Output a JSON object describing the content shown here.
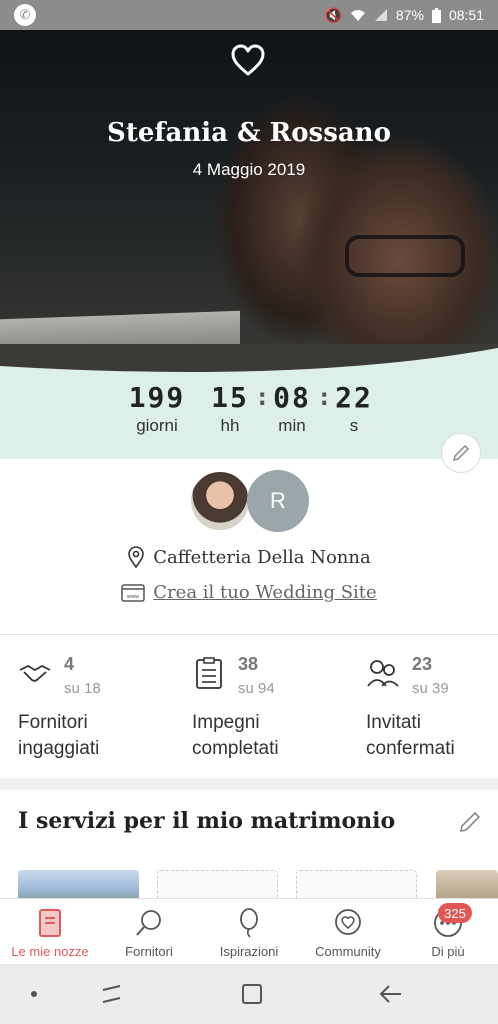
{
  "status_bar": {
    "battery": "87%",
    "time": "08:51"
  },
  "hero": {
    "couple_names": "Stefania & Rossano",
    "wedding_date": "4 Maggio 2019"
  },
  "countdown": {
    "days": "199",
    "days_label": "giorni",
    "hours": "15",
    "hours_label": "hh",
    "minutes": "08",
    "minutes_label": "min",
    "seconds": "22",
    "seconds_label": "s",
    "separator": ":"
  },
  "couple": {
    "partner_initial": "R"
  },
  "venue": {
    "name": "Caffetteria Della Nonna"
  },
  "website": {
    "link_label": "Crea il tuo Wedding Site"
  },
  "stats": [
    {
      "count": "4",
      "total": "su 18",
      "label_line1": "Fornitori",
      "label_line2": "ingaggiati"
    },
    {
      "count": "38",
      "total": "su 94",
      "label_line1": "Impegni",
      "label_line2": "completati"
    },
    {
      "count": "23",
      "total": "su 39",
      "label_line1": "Invitati",
      "label_line2": "confermati"
    }
  ],
  "services": {
    "title": "I servizi per il mio matrimonio"
  },
  "bottom_nav": {
    "items": [
      {
        "label": "Le mie nozze",
        "icon": "notebook-icon"
      },
      {
        "label": "Fornitori",
        "icon": "search-icon"
      },
      {
        "label": "Ispirazioni",
        "icon": "balloon-icon"
      },
      {
        "label": "Community",
        "icon": "chat-heart-icon"
      },
      {
        "label": "Di più",
        "icon": "more-icon"
      }
    ],
    "badge": "325"
  },
  "colors": {
    "accent": "#e05a5a",
    "countdown_bg": "#dcefe9"
  }
}
